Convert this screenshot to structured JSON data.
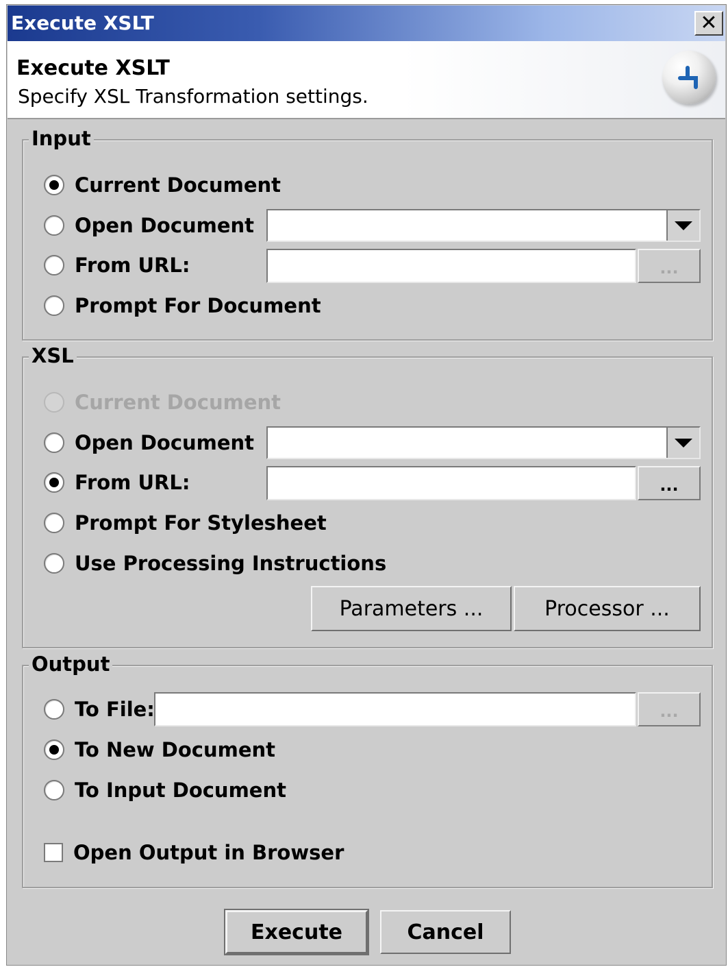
{
  "window": {
    "title": "Execute XSLT",
    "close_label": "✕"
  },
  "header": {
    "title": "Execute XSLT",
    "subtitle": "Specify XSL Transformation settings."
  },
  "input": {
    "legend": "Input",
    "current_document": "Current Document",
    "open_document": "Open Document",
    "from_url": "From URL:",
    "prompt": "Prompt For Document",
    "selected": "current_document",
    "url_value": "",
    "browse_label": "..."
  },
  "xsl": {
    "legend": "XSL",
    "current_document": "Current Document",
    "open_document": "Open Document",
    "from_url": "From URL:",
    "prompt": "Prompt For Stylesheet",
    "use_pi": "Use Processing Instructions",
    "selected": "from_url",
    "url_value": "",
    "browse_label": "...",
    "parameters_label": "Parameters ...",
    "processor_label": "Processor ..."
  },
  "output": {
    "legend": "Output",
    "to_file": "To File:",
    "to_new_document": "To New Document",
    "to_input_document": "To Input Document",
    "open_in_browser": "Open Output in Browser",
    "open_in_browser_checked": false,
    "selected": "to_new_document",
    "file_value": "",
    "browse_label": "..."
  },
  "actions": {
    "execute_label": "Execute",
    "cancel_label": "Cancel"
  }
}
